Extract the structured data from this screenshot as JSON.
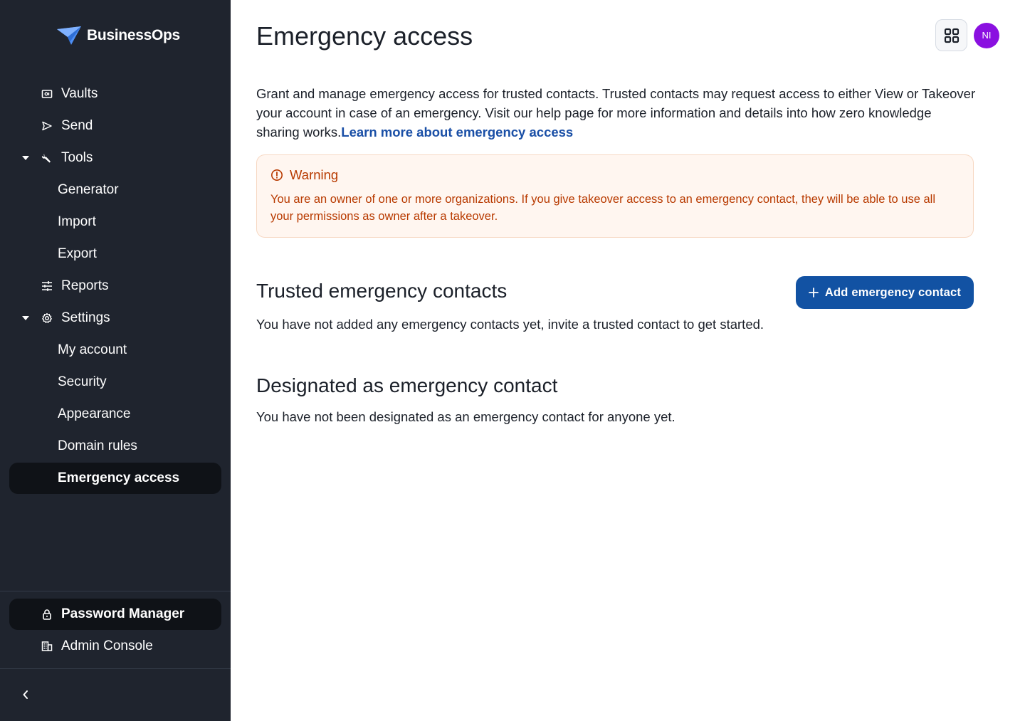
{
  "brand": {
    "name": "BusinessOps"
  },
  "sidebar": {
    "items": [
      {
        "label": "Vaults",
        "icon": "vault-icon"
      },
      {
        "label": "Send",
        "icon": "send-icon"
      },
      {
        "label": "Tools",
        "icon": "wrench-icon",
        "expanded": true
      },
      {
        "label": "Generator"
      },
      {
        "label": "Import"
      },
      {
        "label": "Export"
      },
      {
        "label": "Reports",
        "icon": "sliders-icon"
      },
      {
        "label": "Settings",
        "icon": "gear-icon",
        "expanded": true
      },
      {
        "label": "My account"
      },
      {
        "label": "Security"
      },
      {
        "label": "Appearance"
      },
      {
        "label": "Domain rules"
      },
      {
        "label": "Emergency access",
        "active": true
      }
    ],
    "products": [
      {
        "label": "Password Manager",
        "icon": "lock-icon",
        "active": true
      },
      {
        "label": "Admin Console",
        "icon": "building-icon"
      }
    ]
  },
  "header": {
    "title": "Emergency access",
    "avatar_initials": "NI",
    "avatar_color": "#8a10e0"
  },
  "intro": {
    "text": "Grant and manage emergency access for trusted contacts. Trusted contacts may request access to either View or Takeover your account in case of an emergency. Visit our help page for more information and details into how zero knowledge sharing works.",
    "link": "Learn more about emergency access"
  },
  "warning": {
    "title": "Warning",
    "body": "You are an owner of one or more organizations. If you give takeover access to an emergency contact, they will be able to use all your permissions as owner after a takeover."
  },
  "trusted": {
    "title": "Trusted emergency contacts",
    "empty_text": "You have not added any emergency contacts yet, invite a trusted contact to get started.",
    "add_button": "Add emergency contact"
  },
  "designated": {
    "title": "Designated as emergency contact",
    "empty_text": "You have not been designated as an emergency contact for anyone yet."
  },
  "colors": {
    "sidebar_bg": "#1f242e",
    "primary": "#1252a3",
    "warning": "#b83a00"
  }
}
